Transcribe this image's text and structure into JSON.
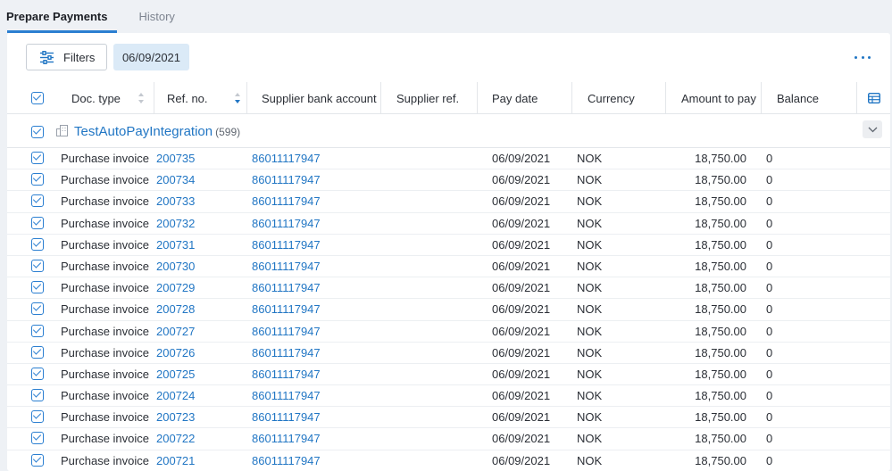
{
  "tabs": [
    {
      "label": "Prepare Payments",
      "active": true
    },
    {
      "label": "History",
      "active": false
    }
  ],
  "toolbar": {
    "filters_label": "Filters",
    "date_chip": "06/09/2021"
  },
  "columns": {
    "doc_type": "Doc. type",
    "ref_no": "Ref. no.",
    "supplier_bank_account": "Supplier bank account",
    "supplier_ref": "Supplier ref.",
    "pay_date": "Pay date",
    "currency": "Currency",
    "amount_to_pay": "Amount to pay",
    "balance": "Balance"
  },
  "group": {
    "name": "TestAutoPayIntegration",
    "count": "(599)"
  },
  "rows": [
    {
      "doc_type": "Purchase invoice",
      "ref_no": "200735",
      "bank_account": "86011117947",
      "pay_date": "06/09/2021",
      "currency": "NOK",
      "amount": "18,750.00",
      "balance": "0"
    },
    {
      "doc_type": "Purchase invoice",
      "ref_no": "200734",
      "bank_account": "86011117947",
      "pay_date": "06/09/2021",
      "currency": "NOK",
      "amount": "18,750.00",
      "balance": "0"
    },
    {
      "doc_type": "Purchase invoice",
      "ref_no": "200733",
      "bank_account": "86011117947",
      "pay_date": "06/09/2021",
      "currency": "NOK",
      "amount": "18,750.00",
      "balance": "0"
    },
    {
      "doc_type": "Purchase invoice",
      "ref_no": "200732",
      "bank_account": "86011117947",
      "pay_date": "06/09/2021",
      "currency": "NOK",
      "amount": "18,750.00",
      "balance": "0"
    },
    {
      "doc_type": "Purchase invoice",
      "ref_no": "200731",
      "bank_account": "86011117947",
      "pay_date": "06/09/2021",
      "currency": "NOK",
      "amount": "18,750.00",
      "balance": "0"
    },
    {
      "doc_type": "Purchase invoice",
      "ref_no": "200730",
      "bank_account": "86011117947",
      "pay_date": "06/09/2021",
      "currency": "NOK",
      "amount": "18,750.00",
      "balance": "0"
    },
    {
      "doc_type": "Purchase invoice",
      "ref_no": "200729",
      "bank_account": "86011117947",
      "pay_date": "06/09/2021",
      "currency": "NOK",
      "amount": "18,750.00",
      "balance": "0"
    },
    {
      "doc_type": "Purchase invoice",
      "ref_no": "200728",
      "bank_account": "86011117947",
      "pay_date": "06/09/2021",
      "currency": "NOK",
      "amount": "18,750.00",
      "balance": "0"
    },
    {
      "doc_type": "Purchase invoice",
      "ref_no": "200727",
      "bank_account": "86011117947",
      "pay_date": "06/09/2021",
      "currency": "NOK",
      "amount": "18,750.00",
      "balance": "0"
    },
    {
      "doc_type": "Purchase invoice",
      "ref_no": "200726",
      "bank_account": "86011117947",
      "pay_date": "06/09/2021",
      "currency": "NOK",
      "amount": "18,750.00",
      "balance": "0"
    },
    {
      "doc_type": "Purchase invoice",
      "ref_no": "200725",
      "bank_account": "86011117947",
      "pay_date": "06/09/2021",
      "currency": "NOK",
      "amount": "18,750.00",
      "balance": "0"
    },
    {
      "doc_type": "Purchase invoice",
      "ref_no": "200724",
      "bank_account": "86011117947",
      "pay_date": "06/09/2021",
      "currency": "NOK",
      "amount": "18,750.00",
      "balance": "0"
    },
    {
      "doc_type": "Purchase invoice",
      "ref_no": "200723",
      "bank_account": "86011117947",
      "pay_date": "06/09/2021",
      "currency": "NOK",
      "amount": "18,750.00",
      "balance": "0"
    },
    {
      "doc_type": "Purchase invoice",
      "ref_no": "200722",
      "bank_account": "86011117947",
      "pay_date": "06/09/2021",
      "currency": "NOK",
      "amount": "18,750.00",
      "balance": "0"
    },
    {
      "doc_type": "Purchase invoice",
      "ref_no": "200721",
      "bank_account": "86011117947",
      "pay_date": "06/09/2021",
      "currency": "NOK",
      "amount": "18,750.00",
      "balance": "0"
    }
  ],
  "icons": {
    "filters": "sliders-icon",
    "more": "more-horizontal-icon",
    "sort_doc_type": "sort-neutral-icon",
    "sort_ref_no": "sort-descending-icon",
    "column_chooser": "table-columns-icon",
    "group": "building-icon",
    "collapse": "chevron-down-icon"
  },
  "colors": {
    "accent": "#2b7fd1",
    "link": "#2176c4",
    "chip_bg": "#dbeaf7",
    "page_bg": "#eef1f5"
  }
}
